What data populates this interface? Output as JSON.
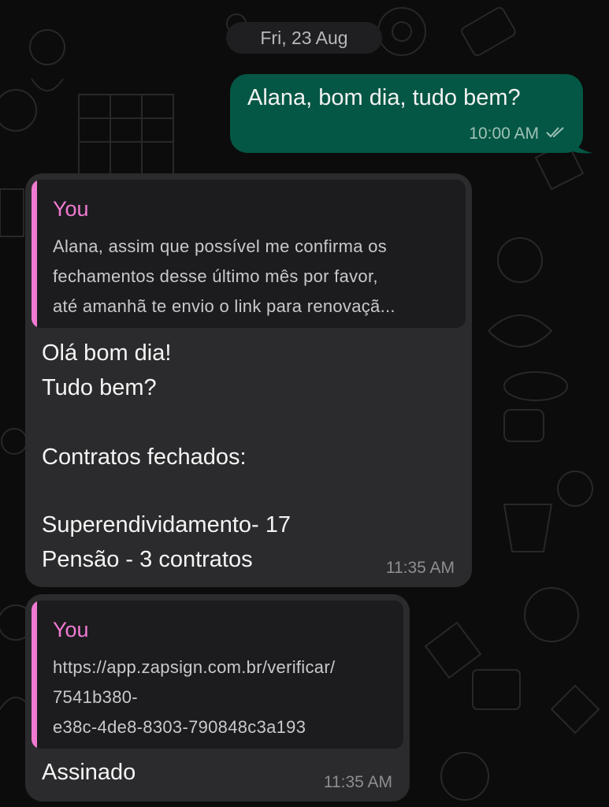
{
  "date_separator": "Fri, 23 Aug",
  "outgoing": {
    "text": "Alana, bom dia, tudo bem?",
    "time": "10:00 AM",
    "status_icon": "double-check-icon"
  },
  "incoming": [
    {
      "quote": {
        "author": "You",
        "lines": [
          "Alana, assim que possível me confirma os",
          "fechamentos desse último mês por favor,",
          "até amanhã te envio o link para renovaçã..."
        ]
      },
      "lines": [
        "Olá bom dia!",
        "Tudo bem?",
        "",
        "Contratos fechados:",
        "",
        "Superendividamento- 17",
        "Pensão - 3 contratos"
      ],
      "time": "11:35 AM"
    },
    {
      "quote": {
        "author": "You",
        "lines": [
          "https://app.zapsign.com.br/verificar/",
          "7541b380-",
          "e38c-4de8-8303-790848c3a193"
        ]
      },
      "lines": [
        "Assinado"
      ],
      "time": "11:35 AM"
    }
  ],
  "colors": {
    "outgoing_bubble": "#045744",
    "incoming_bubble": "#2b2b2d",
    "quote_accent": "#f07ad1",
    "background": "#0c0c0c"
  }
}
